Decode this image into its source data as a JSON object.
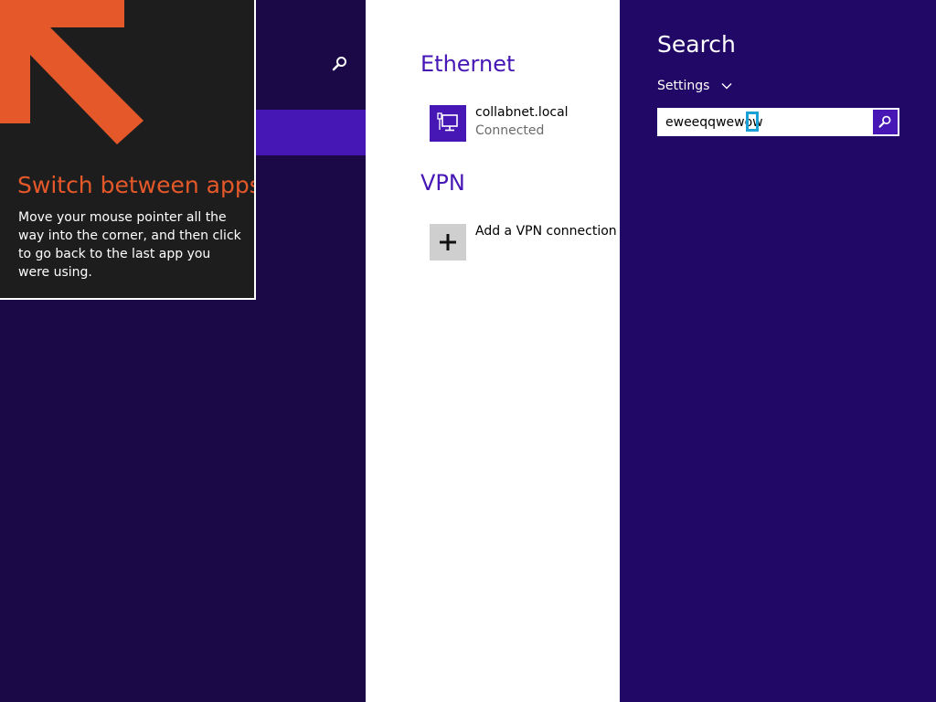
{
  "tip": {
    "title": "Switch between apps",
    "body": "Move your mouse pointer all the way into the corner, and then click to go back to the last app you were using.",
    "accent_color": "#e5582a",
    "arrow_icon": "arrow-up-left-icon"
  },
  "network": {
    "ethernet_title": "Ethernet",
    "ethernet_items": [
      {
        "name": "collabnet.local",
        "status": "Connected",
        "icon": "ethernet-icon"
      }
    ],
    "vpn_title": "VPN",
    "vpn_add_label": "Add a VPN connection",
    "vpn_add_icon": "plus-icon"
  },
  "search": {
    "title": "Search",
    "scope": "Settings",
    "query": "eweeqqwewow",
    "go_icon": "search-icon"
  },
  "colors": {
    "accent": "#4617b4",
    "charm_background": "#220866",
    "desktop_background": "#1b0846",
    "cursor_highlight": "#1aa0d6"
  }
}
